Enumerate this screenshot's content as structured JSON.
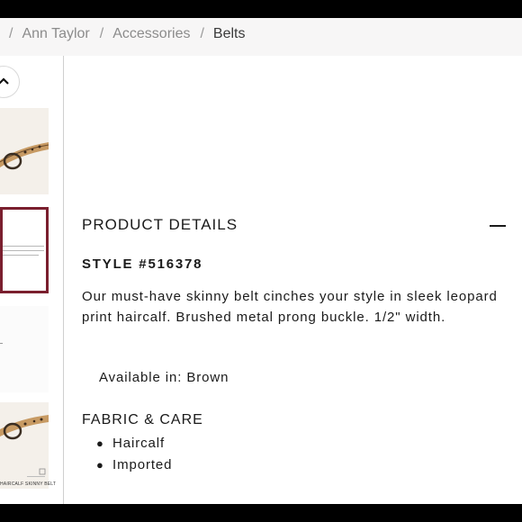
{
  "breadcrumb": {
    "separator": "/",
    "items": [
      "Ann Taylor",
      "Accessories",
      "Belts"
    ]
  },
  "thumbnails": {
    "up_icon": "chevron-up-icon",
    "caption": "HAIRCALF SKINNY BELT",
    "selected_index": 1
  },
  "product_details": {
    "heading": "PRODUCT DETAILS",
    "collapse_icon": "minus-icon",
    "style_number": "STYLE #516378",
    "description": "Our must-have skinny belt cinches your style in sleek leopard print haircalf. Brushed metal prong buckle. 1/2\" width.",
    "availability": "Available in: Brown",
    "fabric_heading": "FABRIC & CARE",
    "fabric_items": [
      "Haircalf",
      "Imported"
    ]
  },
  "colors": {
    "selected_border": "#7a1f2e",
    "letterbox": "#000000",
    "breadcrumb_bg": "#f7f6f6"
  }
}
